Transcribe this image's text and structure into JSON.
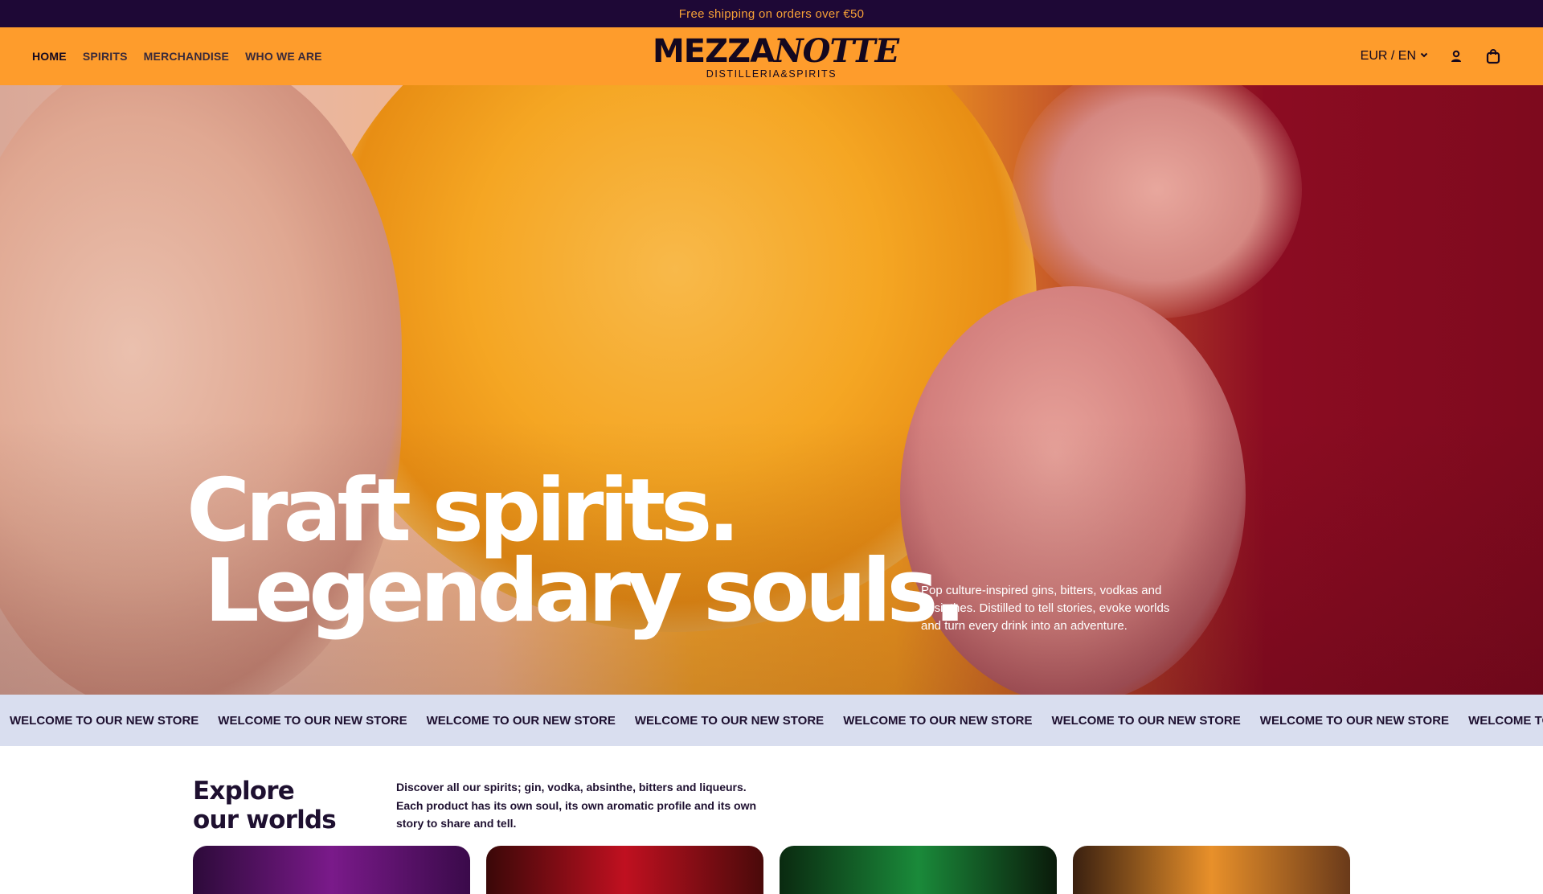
{
  "announcement": "Free shipping on orders over €50",
  "nav": {
    "items": [
      {
        "label": "HOME"
      },
      {
        "label": "SPIRITS"
      },
      {
        "label": "MERCHANDISE"
      },
      {
        "label": "WHO WE ARE"
      }
    ]
  },
  "logo": {
    "main_bold": "MEZZA",
    "main_script": "NOTTE",
    "subtitle": "DISTILLERIA&SPIRITS"
  },
  "header_right": {
    "locale": "EUR / EN",
    "account_icon": "user-icon",
    "cart_icon": "bag-icon"
  },
  "hero": {
    "headline_line1": "Craft spirits.",
    "headline_line2": "Legendary souls.",
    "description": "Pop culture-inspired gins, bitters, vodkas and absinthes. Distilled to tell stories, evoke worlds and turn every drink into an adventure."
  },
  "ticker": {
    "text": "WELCOME TO OUR NEW STORE"
  },
  "explore": {
    "title_line1": "Explore",
    "title_line2": "our worlds",
    "description": "Discover all our spirits; gin, vodka, absinthe, bitters and liqueurs. Each product has its own soul, its own aromatic profile and its own story to share and tell."
  },
  "colors": {
    "announcement_bg": "#1e0836",
    "announcement_text": "#f6a037",
    "header_bg": "#fe9c2c",
    "ticker_bg": "#d9deef",
    "text_dark": "#1e1030"
  }
}
